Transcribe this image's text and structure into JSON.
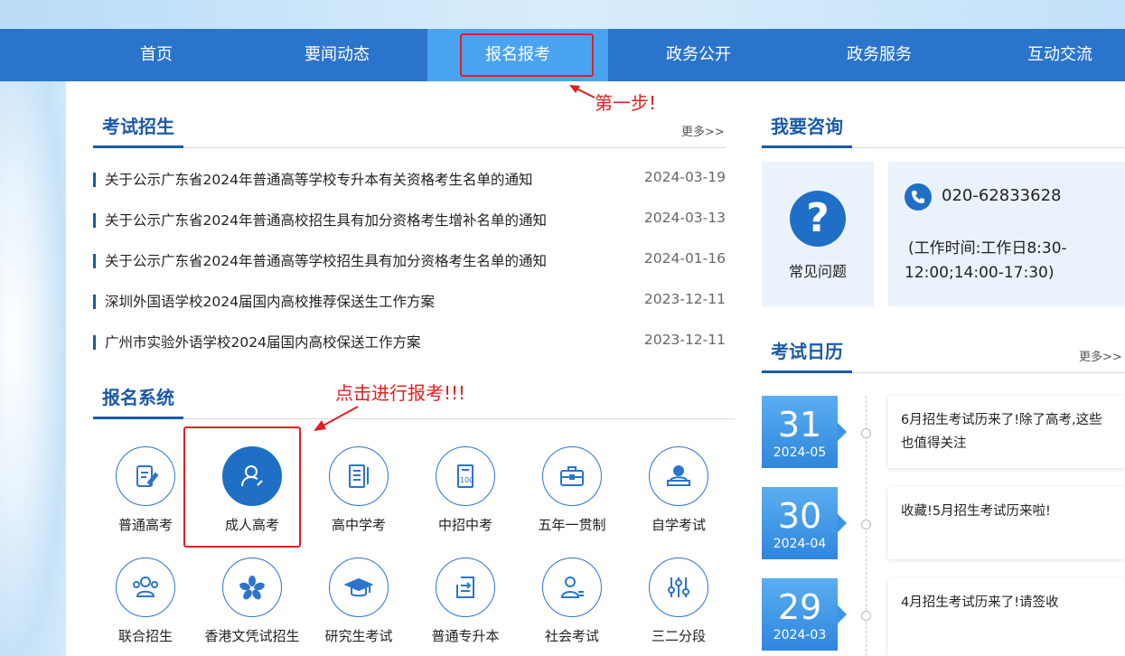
{
  "nav": {
    "items": [
      "首页",
      "要闻动态",
      "报名报考",
      "政务公开",
      "政务服务",
      "互动交流"
    ],
    "active_index": 2
  },
  "annotations": {
    "step1": "第一步!",
    "click_signup": "点击进行报考!!!"
  },
  "exam_recruit": {
    "title": "考试招生",
    "more": "更多>>",
    "news": [
      {
        "title": "关于公示广东省2024年普通高等学校专升本有关资格考生名单的通知",
        "date": "2024-03-19"
      },
      {
        "title": "关于公示广东省2024年普通高校招生具有加分资格考生增补名单的通知",
        "date": "2024-03-13"
      },
      {
        "title": "关于公示广东省2024年普通高等学校招生具有加分资格考生名单的通知",
        "date": "2024-01-16"
      },
      {
        "title": "深圳外国语学校2024届国内高校推荐保送生工作方案",
        "date": "2023-12-11"
      },
      {
        "title": "广州市实验外语学校2024届国内高校保送工作方案",
        "date": "2023-12-11"
      }
    ]
  },
  "signup_system": {
    "title": "报名系统",
    "items": [
      {
        "label": "普通高考",
        "icon": "exam-paper-icon"
      },
      {
        "label": "成人高考",
        "icon": "adult-person-icon"
      },
      {
        "label": "高中学考",
        "icon": "notebook-icon"
      },
      {
        "label": "中招中考",
        "icon": "score-sheet-icon"
      },
      {
        "label": "五年一贯制",
        "icon": "briefcase-icon"
      },
      {
        "label": "自学考试",
        "icon": "self-study-icon"
      },
      {
        "label": "联合招生",
        "icon": "group-people-icon"
      },
      {
        "label": "香港文凭试招生",
        "icon": "bauhinia-icon"
      },
      {
        "label": "研究生考试",
        "icon": "graduation-cap-icon"
      },
      {
        "label": "普通专升本",
        "icon": "upgrade-arrow-icon"
      },
      {
        "label": "社会考试",
        "icon": "social-person-icon"
      },
      {
        "label": "三二分段",
        "icon": "sliders-icon"
      }
    ]
  },
  "consult": {
    "title": "我要咨询",
    "faq_label": "常见问题",
    "phone": "020-62833628",
    "hours_line1": "(工作时间:工作日8:30-",
    "hours_line2": "12:00;14:00-17:30)"
  },
  "calendar": {
    "title": "考试日历",
    "more": "更多>>",
    "entries": [
      {
        "day": "31",
        "month": "2024-05",
        "text": "6月招生考试历来了!除了高考,这些也值得关注"
      },
      {
        "day": "30",
        "month": "2024-04",
        "text": "收藏!5月招生考试历来啦!"
      },
      {
        "day": "29",
        "month": "2024-03",
        "text": "4月招生考试历来了!请签收"
      }
    ]
  },
  "colors": {
    "nav_bg": "#2b74cc",
    "nav_active": "#4aa3f0",
    "title_blue": "#1a5aa8",
    "annotation_red": "#e02020"
  }
}
